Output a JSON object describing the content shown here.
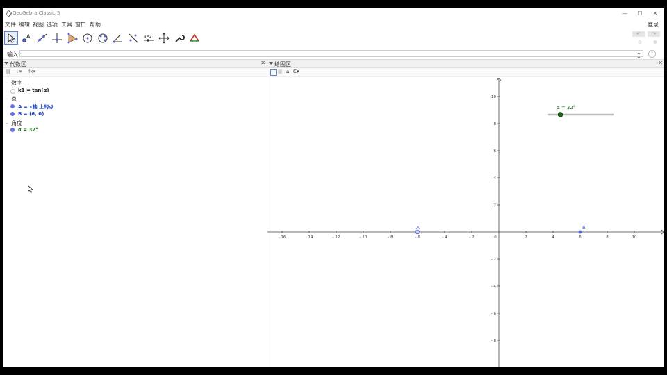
{
  "app": {
    "title": "GeoGebra Classic 5"
  },
  "window_controls": {
    "minimize": "—",
    "maximize": "☐",
    "close": "✕"
  },
  "menu": {
    "items": [
      "文件",
      "编辑",
      "视图",
      "选项",
      "工具",
      "窗口",
      "帮助"
    ],
    "login": "登录"
  },
  "toolbar": {
    "tools": [
      "move-tool-icon",
      "point-tool-icon",
      "line-tool-icon",
      "perpendicular-tool-icon",
      "polygon-tool-icon",
      "circle-tool-icon",
      "conic-tool-icon",
      "angle-tool-icon",
      "reflect-tool-icon",
      "slider-tool-icon",
      "move-view-tool-icon",
      "wrench-tool-icon",
      "function-tool-icon"
    ],
    "slider_tool_label": "a=2",
    "undo": "↶",
    "redo": "↷"
  },
  "input_bar": {
    "label": "输入:",
    "value": "",
    "help": "?"
  },
  "algebra": {
    "title": "代数区",
    "close": "✕",
    "sort_label": "↓▾",
    "fx_label": "fx▾",
    "categories": [
      {
        "name": "数字",
        "items": [
          {
            "text": "k1 = tan(α)",
            "color": "#111111",
            "dot": "empty"
          }
        ]
      },
      {
        "name": "点",
        "items": [
          {
            "text": "A = x轴 上的点",
            "color": "#1a3fc4",
            "dot": "#6670e8"
          },
          {
            "text": "B = (6, 0)",
            "color": "#1a3fc4",
            "dot": "#6670e8"
          }
        ]
      },
      {
        "name": "角度",
        "items": [
          {
            "text": "α = 32°",
            "color": "#1e6b1e",
            "dot": "#6670e8"
          }
        ]
      }
    ]
  },
  "graphics": {
    "title": "绘图区",
    "close": "✕",
    "home": "⌂",
    "style_label": "C▾",
    "x_ticks": [
      "- 16",
      "- 14",
      "- 12",
      "- 10",
      "- 8",
      "- 6",
      "- 4",
      "- 2",
      "0",
      "2",
      "4",
      "6",
      "8",
      "10"
    ],
    "y_ticks": [
      "10",
      "8",
      "6",
      "4",
      "2",
      "- 2",
      "- 4",
      "- 6",
      "- 8"
    ],
    "point_A": {
      "label": "A",
      "x": -6,
      "y": 0,
      "color": "#5565d8"
    },
    "point_B": {
      "label": "B",
      "x": 6,
      "y": 0,
      "color": "#5565d8"
    },
    "slider": {
      "label": "α = 32°",
      "fraction": 0.18,
      "color": "#1e6b1e"
    }
  }
}
